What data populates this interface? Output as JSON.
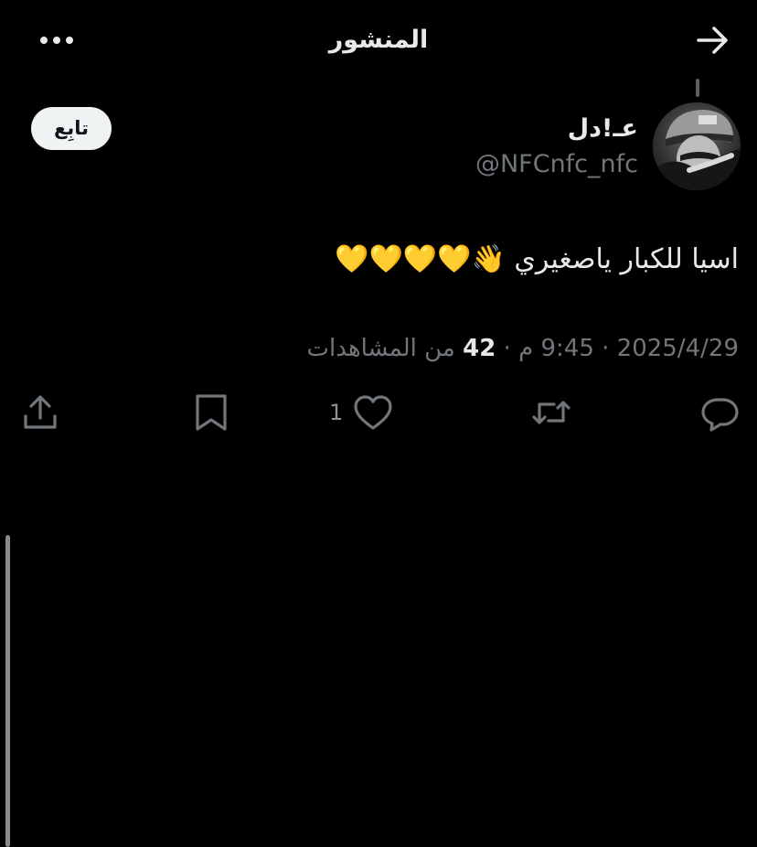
{
  "header": {
    "title": "المنشور",
    "more_icon": "more-horizontal-icon",
    "back_icon": "arrow-right-icon"
  },
  "author": {
    "display_name": "عـ!دل",
    "handle": "@NFCnfc_nfc",
    "follow_label": "تابِع"
  },
  "tweet": {
    "text": "اسيا للكبار ياصغيري 👋💛💛💛💛"
  },
  "meta": {
    "date": "2025/4/29",
    "time": "9:45 م",
    "separator": " · ",
    "views_count": "42",
    "views_label": "من المشاهدات"
  },
  "actions": {
    "reply_icon": "reply-icon",
    "retweet_icon": "retweet-icon",
    "like_icon": "heart-icon",
    "like_count": "1",
    "bookmark_icon": "bookmark-icon",
    "share_icon": "share-icon"
  },
  "colors": {
    "background": "#000000",
    "primary_text": "#e7e9ea",
    "secondary_text": "#71767b",
    "follow_button_bg": "#eff3f4"
  }
}
